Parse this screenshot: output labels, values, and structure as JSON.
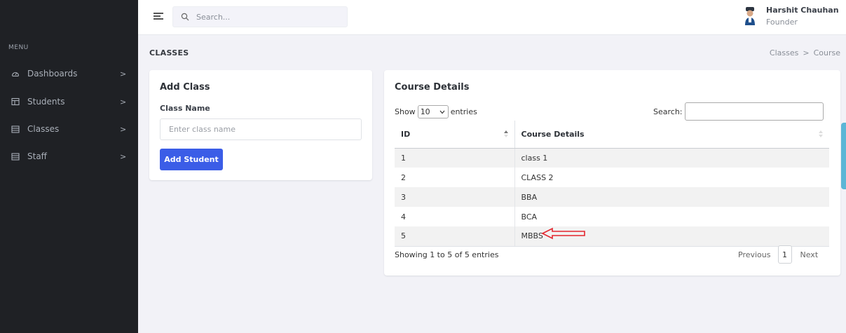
{
  "sidebar": {
    "menu_title": "MENU",
    "items": [
      {
        "label": "Dashboards",
        "icon": "gauge-icon",
        "chevron": ">"
      },
      {
        "label": "Students",
        "icon": "table-icon",
        "chevron": ">"
      },
      {
        "label": "Classes",
        "icon": "calendar-icon",
        "chevron": ">"
      },
      {
        "label": "Staff",
        "icon": "calendar-icon",
        "chevron": ">"
      }
    ]
  },
  "topbar": {
    "search_placeholder": "Search...",
    "user_name": "Harshit Chauhan",
    "user_role": "Founder"
  },
  "page": {
    "title": "CLASSES",
    "breadcrumb": [
      "Classes",
      "Course"
    ],
    "breadcrumb_sep": ">"
  },
  "add_class": {
    "title": "Add Class",
    "field_label": "Class Name",
    "placeholder": "Enter class name",
    "button": "Add Student"
  },
  "course": {
    "title": "Course Details",
    "show_label": "Show",
    "entries_label": "entries",
    "length_value": "10",
    "search_label": "Search:",
    "columns": [
      "ID",
      "Course Details"
    ],
    "rows": [
      {
        "id": "1",
        "name": "class 1"
      },
      {
        "id": "2",
        "name": "CLASS 2"
      },
      {
        "id": "3",
        "name": "BBA"
      },
      {
        "id": "4",
        "name": "BCA"
      },
      {
        "id": "5",
        "name": "MBBS"
      }
    ],
    "info": "Showing 1 to 5 of 5 entries",
    "prev": "Previous",
    "page": "1",
    "next": "Next"
  },
  "colors": {
    "sidebar_bg": "#1f2125",
    "primary": "#3b5de7",
    "annotation_arrow": "#e3262e",
    "scroll_tab": "#5bb6d6"
  }
}
